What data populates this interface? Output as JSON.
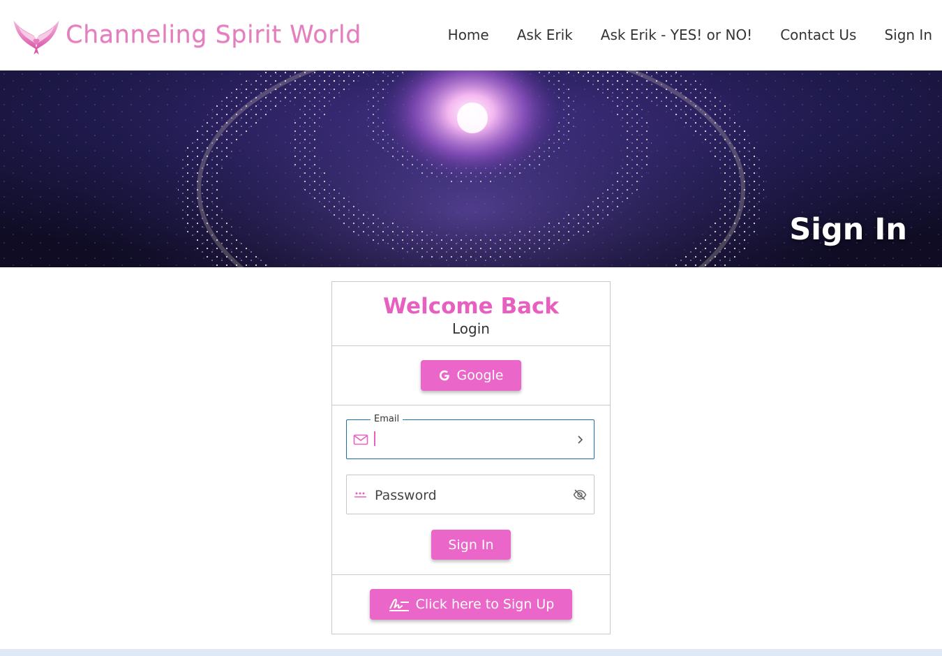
{
  "header": {
    "logo_text": "Channeling Spirit World",
    "logo_icon": "winged-heart-logo",
    "nav": [
      {
        "label": "Home"
      },
      {
        "label": "Ask Erik"
      },
      {
        "label": "Ask Erik - YES! or NO!"
      },
      {
        "label": "Contact Us"
      },
      {
        "label": "Sign In"
      }
    ]
  },
  "hero": {
    "title": "Sign In"
  },
  "card": {
    "welcome": "Welcome Back",
    "subtitle": "Login",
    "google_button": "Google",
    "email": {
      "label": "Email",
      "value": "",
      "icon": "mail-icon",
      "action_icon": "chevron-right-icon"
    },
    "password": {
      "placeholder": "Password",
      "icon": "password-dots-icon",
      "action_icon": "eye-off-icon"
    },
    "signin_button": "Sign In",
    "signup_button": "Click here to Sign Up"
  },
  "colors": {
    "accent": "#ea66c8",
    "logo": "#e37fbf",
    "focus": "#1d6fa6"
  }
}
